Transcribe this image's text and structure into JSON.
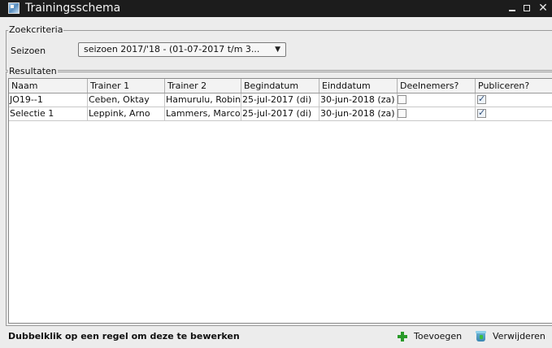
{
  "window": {
    "title": "Trainingsschema"
  },
  "search": {
    "group_label": "Zoekcriteria",
    "season_label": "Seizoen",
    "season_value": "seizoen 2017/'18 - (01-07-2017 t/m 3..."
  },
  "results": {
    "group_label": "Resultaten",
    "columns": [
      "Naam",
      "Trainer 1",
      "Trainer 2",
      "Begindatum",
      "Einddatum",
      "Deelnemers?",
      "Publiceren?"
    ],
    "rows": [
      {
        "naam": "JO19--1",
        "trainer1": "Ceben, Oktay",
        "trainer2": "Hamurulu, Robin",
        "begindatum": "25-jul-2017 (di)",
        "einddatum": "30-jun-2018 (za)",
        "deelnemers": false,
        "publiceren": true
      },
      {
        "naam": "Selectie 1",
        "trainer1": "Leppink, Arno",
        "trainer2": "Lammers, Marco",
        "begindatum": "25-jul-2017 (di)",
        "einddatum": "30-jun-2018 (za)",
        "deelnemers": false,
        "publiceren": true
      }
    ]
  },
  "footer": {
    "hint": "Dubbelklik op een regel om deze te bewerken",
    "add_label": "Toevoegen",
    "add_icon": "plus-icon",
    "delete_label": "Verwijderen",
    "delete_icon": "trash-icon"
  },
  "colors": {
    "titlebar": "#1c1c1c",
    "window_bg": "#ececec",
    "add_icon": "#2a9a2a"
  }
}
